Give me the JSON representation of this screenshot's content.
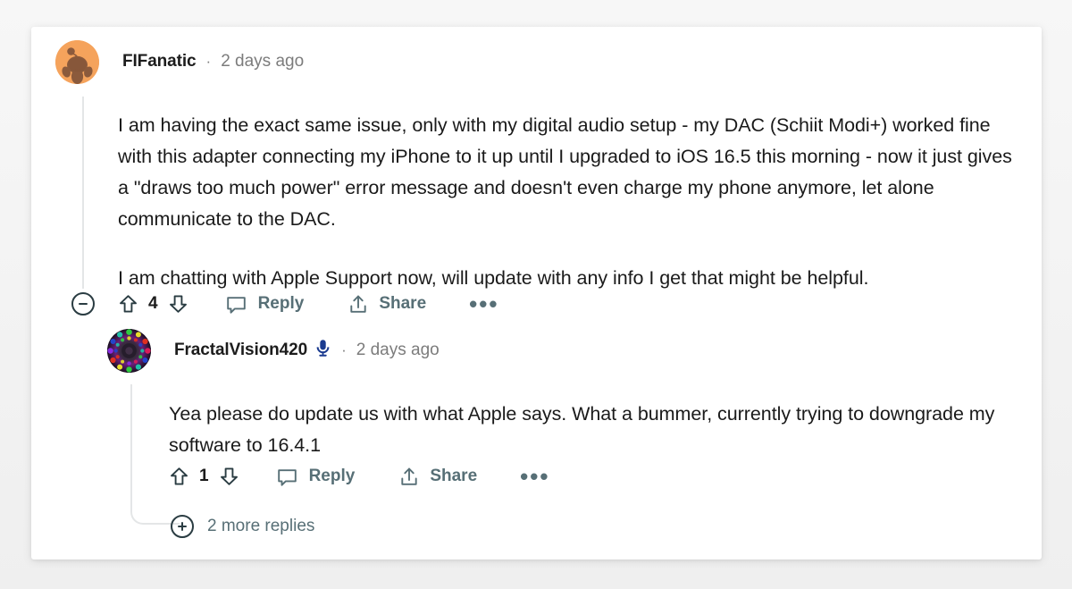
{
  "thread": {
    "top_comment": {
      "author": "FIFanatic",
      "separator": "·",
      "age": "2 days ago",
      "avatar_icon": "reddit-snoo-avatar",
      "avatar_bg": "#f5a35c",
      "avatar_fg": "#8b5a3c",
      "paragraphs": [
        "I am having the exact same issue, only with my digital audio setup - my DAC (Schiit Modi+) worked fine with this adapter connecting my iPhone to it up until I upgraded to iOS 16.5 this morning - now it just gives a \"draws too much power\" error message and doesn't even charge my phone anymore, let alone communicate to the DAC.",
        "I am chatting with Apple Support now, will update with any info I get that might be helpful."
      ],
      "actions": {
        "collapse_icon": "minus-circle-icon",
        "upvote_icon": "upvote-arrow-icon",
        "score": "4",
        "downvote_icon": "downvote-arrow-icon",
        "reply_icon": "comment-bubble-icon",
        "reply_label": "Reply",
        "share_icon": "share-upload-icon",
        "share_label": "Share",
        "overflow_icon": "ellipsis-icon",
        "overflow_label": "•••"
      }
    },
    "reply": {
      "author": "FractalVision420",
      "badge_icon": "microphone-icon",
      "badge_color": "#1a3a8f",
      "separator": "·",
      "age": "2 days ago",
      "avatar_icon": "fractal-mandala-avatar",
      "paragraphs": [
        "Yea please do update us with what Apple says. What a bummer, currently trying to downgrade my software to 16.4.1"
      ],
      "actions": {
        "upvote_icon": "upvote-arrow-icon",
        "score": "1",
        "downvote_icon": "downvote-arrow-icon",
        "reply_icon": "comment-bubble-icon",
        "reply_label": "Reply",
        "share_icon": "share-upload-icon",
        "share_label": "Share",
        "overflow_icon": "ellipsis-icon",
        "overflow_label": "•••"
      }
    },
    "more_replies": {
      "expand_icon": "plus-circle-icon",
      "label": "2 more replies"
    }
  },
  "colors": {
    "page_bg": "#f2f2f2",
    "card_bg": "#ffffff",
    "text_primary": "#1a1a1a",
    "text_muted": "#7c7c7c",
    "action_text": "#576f76",
    "thread_line": "#e4e6e7"
  }
}
